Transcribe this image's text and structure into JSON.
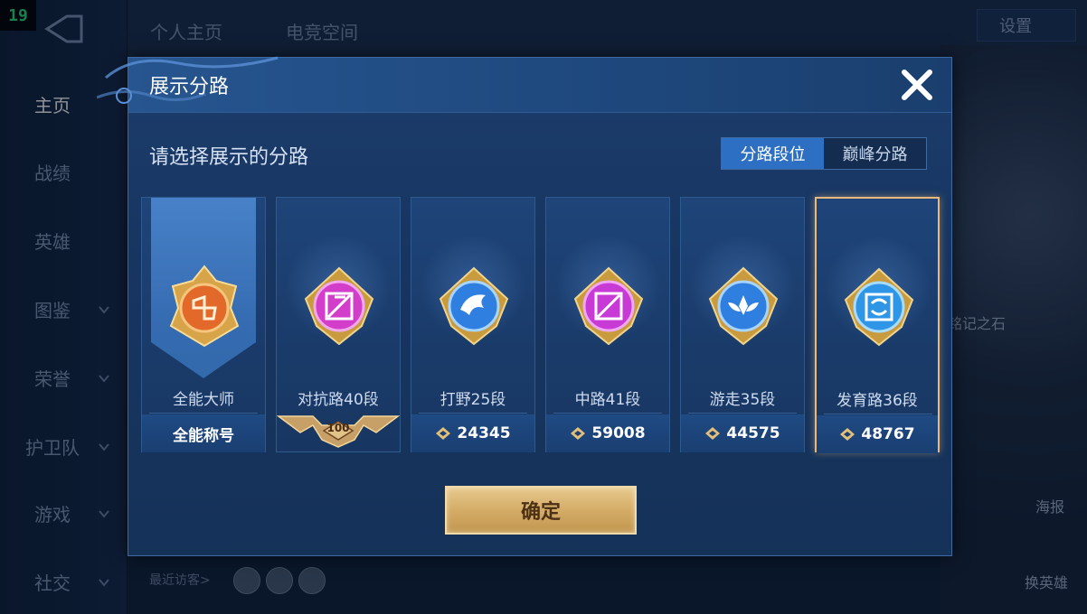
{
  "fps_counter": "19",
  "nav": {
    "items": [
      {
        "label": "主页",
        "active": true
      },
      {
        "label": "战绩"
      },
      {
        "label": "英雄"
      },
      {
        "label": "图鉴",
        "chevron": true
      },
      {
        "label": "荣誉",
        "chevron": true
      },
      {
        "label": "护卫队",
        "chevron": true
      },
      {
        "label": "游戏",
        "chevron": true
      },
      {
        "label": "社交",
        "chevron": true
      }
    ]
  },
  "top_tabs": [
    "个人主页",
    "电竞空间"
  ],
  "top_right": {
    "settings": "设置"
  },
  "background_right": {
    "side_label": "铭记之石",
    "poster": "海报",
    "switch_hero": "换英雄"
  },
  "visitors_label": "最近访客>",
  "modal": {
    "title": "展示分路",
    "subtitle": "请选择展示的分路",
    "toggle": {
      "option_1": "分路段位",
      "option_2": "巅峰分路",
      "selected": "分路段位"
    },
    "cards": [
      {
        "name": "全能大师",
        "footer": "全能称号",
        "emblem_color": "#e2692a"
      },
      {
        "name": "对抗路40段",
        "ribbon": "100",
        "emblem_color": "#d23ec9"
      },
      {
        "name": "打野25段",
        "footer": "24345",
        "emblem_color": "#2f7fe0"
      },
      {
        "name": "中路41段",
        "footer": "59008",
        "emblem_color": "#c83ad6"
      },
      {
        "name": "游走35段",
        "footer": "44575",
        "emblem_color": "#2f7fe0"
      },
      {
        "name": "发育路36段",
        "footer": "48767",
        "emblem_color": "#2f95e6",
        "selected": true
      }
    ],
    "confirm_label": "确定"
  }
}
